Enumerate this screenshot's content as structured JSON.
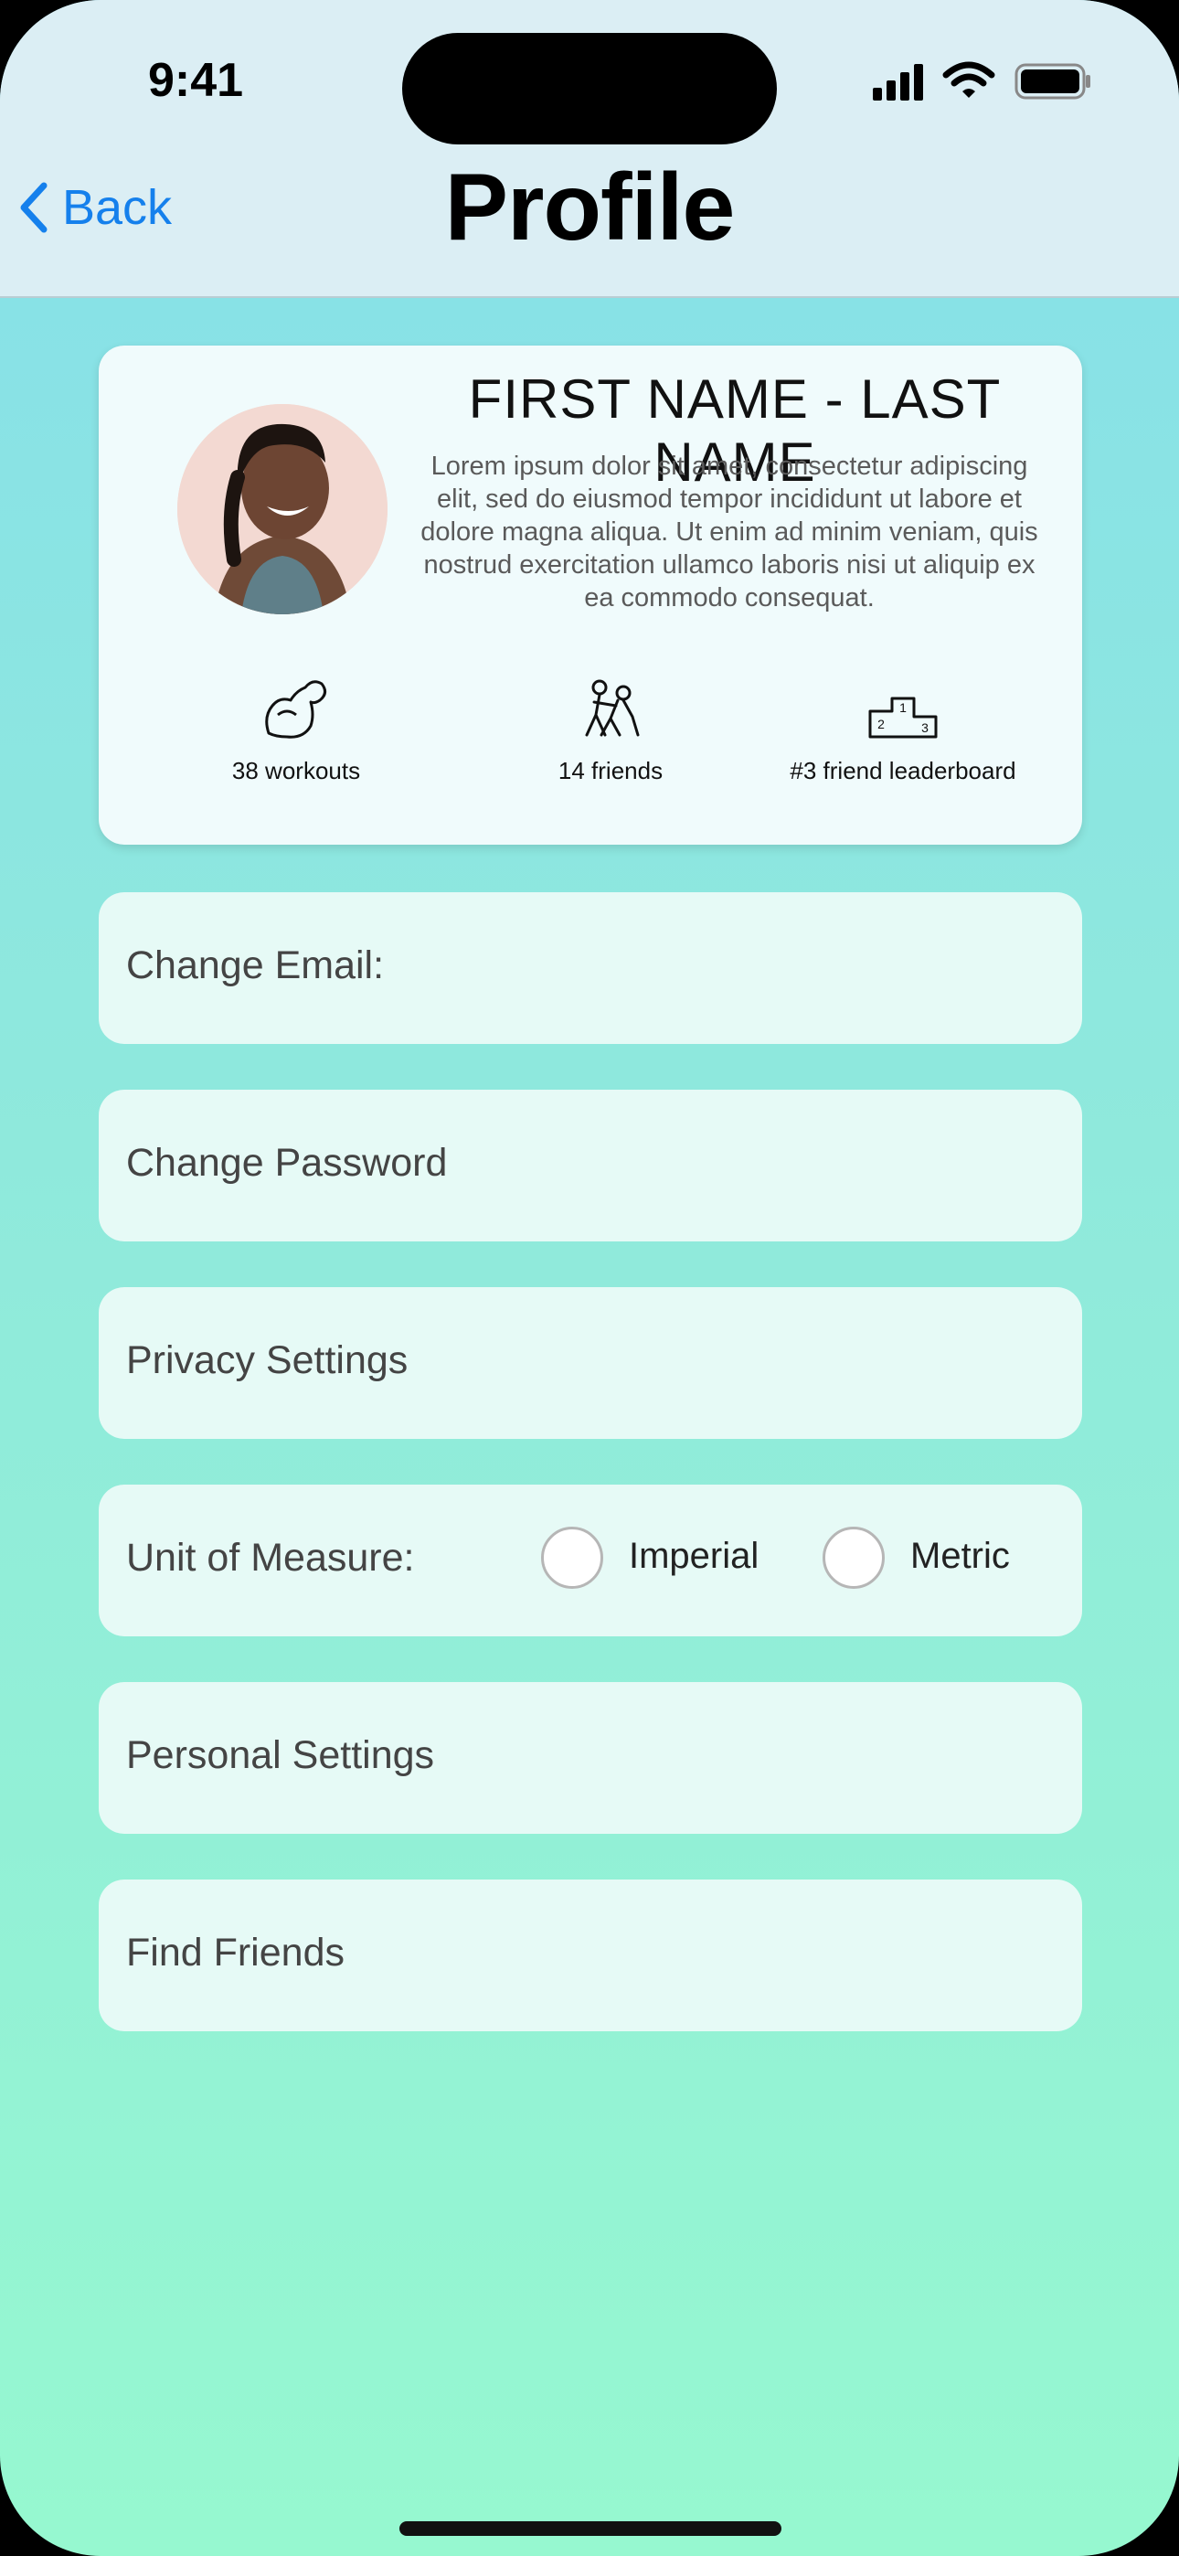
{
  "status_bar": {
    "time": "9:41"
  },
  "nav": {
    "back_label": "Back",
    "title": "Profile"
  },
  "profile": {
    "name": "FIRST NAME - LAST NAME",
    "bio": "Lorem ipsum dolor sit amet, consectetur adipiscing elit, sed do eiusmod tempor incididunt ut labore et dolore magna aliqua. Ut enim ad minim veniam, quis nostrud exercitation ullamco laboris nisi ut aliquip ex ea commodo consequat.",
    "stats": [
      {
        "icon": "flexed-arm-icon",
        "label": "38 workouts"
      },
      {
        "icon": "wrestlers-icon",
        "label": "14 friends"
      },
      {
        "icon": "podium-icon",
        "label": "#3 friend leaderboard"
      }
    ]
  },
  "settings": {
    "change_email": "Change Email:",
    "change_password": "Change Password",
    "privacy": "Privacy Settings",
    "unit_label": "Unit of Measure:",
    "unit_options": [
      "Imperial",
      "Metric"
    ],
    "personal": "Personal Settings",
    "find_friends": "Find Friends"
  },
  "colors": {
    "accent": "#1580ec",
    "header_bg": "#dbeef4",
    "gradient_top": "#86dfea",
    "gradient_bottom": "#96f8d0",
    "card_bg": "#f0fbfc",
    "row_bg": "#e6faf6"
  }
}
